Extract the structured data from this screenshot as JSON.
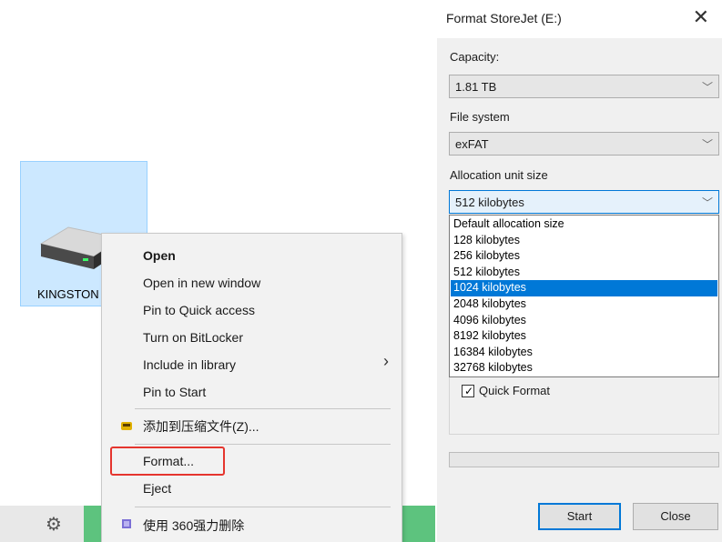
{
  "drive": {
    "label": "KINGSTON",
    "icon": "hard-drive-icon"
  },
  "context_menu": {
    "items": [
      {
        "label": "Open"
      },
      {
        "label": "Open in new window"
      },
      {
        "label": "Pin to Quick access"
      },
      {
        "label": "Turn on BitLocker"
      },
      {
        "label": "Include in library"
      },
      {
        "label": "Pin to Start"
      },
      {
        "label": "添加到压缩文件(Z)..."
      },
      {
        "label": "Format..."
      },
      {
        "label": "Eject"
      },
      {
        "label": "使用 360强力删除"
      }
    ],
    "highlight_color": "#e5352e"
  },
  "dialog": {
    "title": "Format StoreJet (E:)",
    "capacity_label": "Capacity:",
    "capacity_value": "1.81 TB",
    "filesystem_label": "File system",
    "filesystem_value": "exFAT",
    "alloc_label": "Allocation unit size",
    "alloc_value": "512 kilobytes",
    "alloc_options": [
      "Default allocation size",
      "128 kilobytes",
      "256 kilobytes",
      "512 kilobytes",
      "1024 kilobytes",
      "2048 kilobytes",
      "4096 kilobytes",
      "8192 kilobytes",
      "16384 kilobytes",
      "32768 kilobytes"
    ],
    "alloc_highlighted": "1024 kilobytes",
    "quick_format_label": "Quick Format",
    "quick_format_checked": true,
    "start_label": "Start",
    "close_label": "Close",
    "accent_color": "#0078d7"
  }
}
